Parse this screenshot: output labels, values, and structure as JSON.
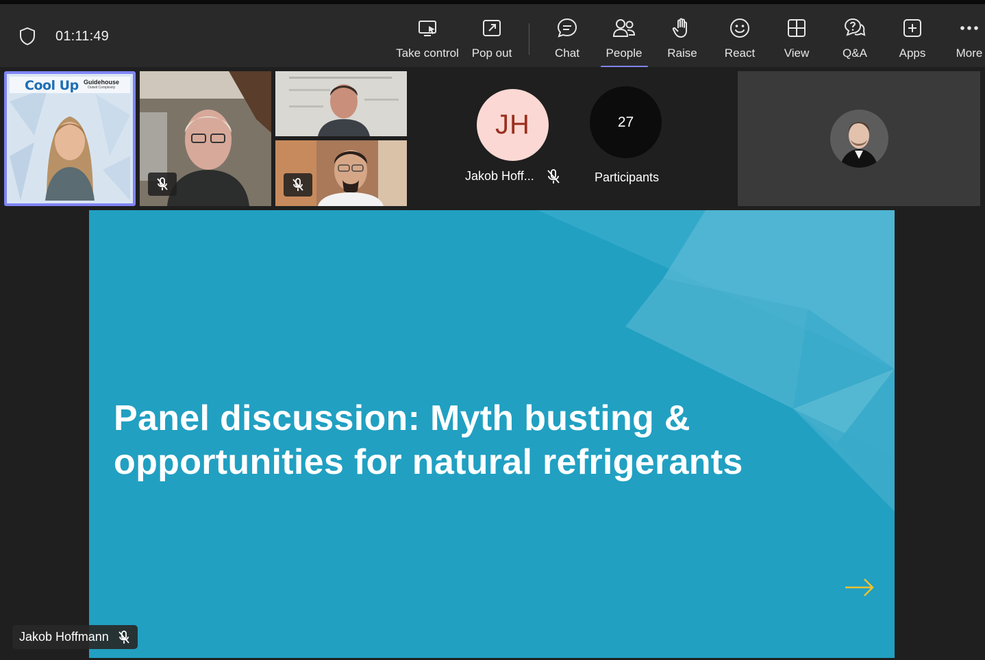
{
  "meeting": {
    "timer": "01:11:49"
  },
  "toolbar": {
    "items": [
      {
        "id": "take-control",
        "label": "Take control",
        "icon": "screen-pointer-icon"
      },
      {
        "id": "pop-out",
        "label": "Pop out",
        "icon": "pop-out-icon"
      },
      {
        "id": "chat",
        "label": "Chat",
        "icon": "chat-bubble-icon"
      },
      {
        "id": "people",
        "label": "People",
        "icon": "people-icon",
        "active": true
      },
      {
        "id": "raise",
        "label": "Raise",
        "icon": "hand-icon"
      },
      {
        "id": "react",
        "label": "React",
        "icon": "smiley-icon"
      },
      {
        "id": "view",
        "label": "View",
        "icon": "grid-icon"
      },
      {
        "id": "qa",
        "label": "Q&A",
        "icon": "question-bubble-icon"
      },
      {
        "id": "apps",
        "label": "Apps",
        "icon": "plus-box-icon"
      },
      {
        "id": "more",
        "label": "More",
        "icon": "ellipsis-icon"
      }
    ],
    "active_color": "#7f85f5"
  },
  "video_strip": {
    "tile1": {
      "brand_left": "Cool Up",
      "brand_right": "Guidehouse",
      "brand_right_sub": "Outwit Complexity",
      "speaking": true
    },
    "tile2": {
      "muted": true
    },
    "tile3": {
      "muted": false
    },
    "tile4": {
      "muted": true
    }
  },
  "participant_jh": {
    "initials": "JH",
    "name": "Jakob Hoff...",
    "muted": true
  },
  "participants": {
    "count": "27",
    "label": "Participants"
  },
  "slide": {
    "title_line1": "Panel discussion: Myth busting &",
    "title_line2": "opportunities for natural refrigerants",
    "background": "#21a0c2",
    "arrow_color": "#f2c12e"
  },
  "presenter": {
    "name": "Jakob Hoffmann",
    "muted": true
  }
}
